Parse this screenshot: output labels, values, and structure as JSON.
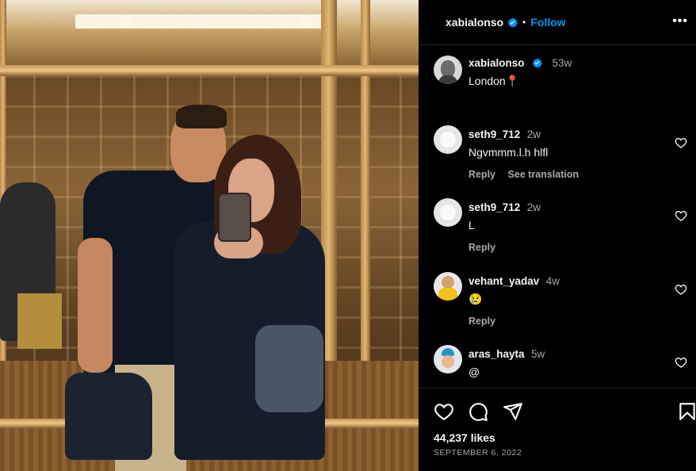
{
  "post": {
    "username": "xabialonso",
    "follow_label": "Follow",
    "more_label": "•••",
    "caption": {
      "username": "xabialonso",
      "time": "53w",
      "text": "London📍"
    },
    "likes": "44,237 likes",
    "date": "SEPTEMBER 6, 2022"
  },
  "comments": [
    {
      "username": "seth9_712",
      "time": "2w",
      "text": "Ngvmmm.l.h hlfl",
      "reply": "Reply",
      "translate": "See translation"
    },
    {
      "username": "seth9_712",
      "time": "2w",
      "text": "L",
      "reply": "Reply"
    },
    {
      "username": "vehant_yadav",
      "time": "4w",
      "text": "😢",
      "reply": "Reply"
    },
    {
      "username": "aras_hayta",
      "time": "5w",
      "text": "@"
    }
  ],
  "icons": [
    "verified-badge-icon",
    "heart-icon",
    "comment-icon",
    "share-icon",
    "bookmark-icon",
    "more-icon"
  ],
  "colors": {
    "accent": "#0095f6",
    "background": "#000000",
    "muted": "#a8a8a8",
    "divider": "#262626"
  }
}
